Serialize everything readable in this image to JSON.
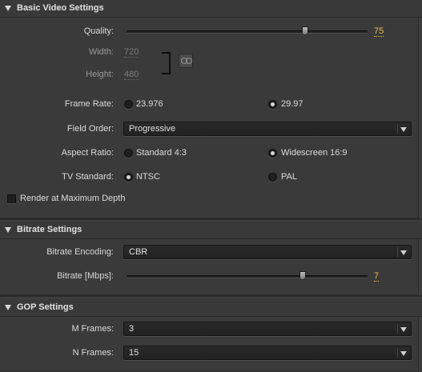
{
  "basic": {
    "header": "Basic Video Settings",
    "quality_label": "Quality:",
    "quality_value": "75",
    "quality_fraction": 0.74,
    "width_label": "Width:",
    "width_value": "720",
    "height_label": "Height:",
    "height_value": "480",
    "frame_rate_label": "Frame Rate:",
    "frame_rate_options": [
      "23.976",
      "29.97"
    ],
    "frame_rate_selected": "29.97",
    "field_order_label": "Field Order:",
    "field_order_value": "Progressive",
    "aspect_label": "Aspect Ratio:",
    "aspect_options": [
      "Standard 4:3",
      "Widescreen 16:9"
    ],
    "aspect_selected": "Widescreen 16:9",
    "tv_label": "TV Standard:",
    "tv_options": [
      "NTSC",
      "PAL"
    ],
    "tv_selected": "NTSC",
    "render_max_depth_label": "Render at Maximum Depth",
    "render_max_depth_checked": false
  },
  "bitrate": {
    "header": "Bitrate Settings",
    "encoding_label": "Bitrate Encoding:",
    "encoding_value": "CBR",
    "bitrate_label": "Bitrate [Mbps]:",
    "bitrate_value": "7",
    "bitrate_fraction": 0.73
  },
  "gop": {
    "header": "GOP Settings",
    "m_frames_label": "M Frames:",
    "m_frames_value": "3",
    "n_frames_label": "N Frames:",
    "n_frames_value": "15"
  },
  "colors": {
    "accent_value": "#e8b84a",
    "background": "#3d3d3d"
  },
  "icons": [
    "disclosure-triangle-icon",
    "chain-link-icon",
    "dropdown-arrow-icon"
  ]
}
